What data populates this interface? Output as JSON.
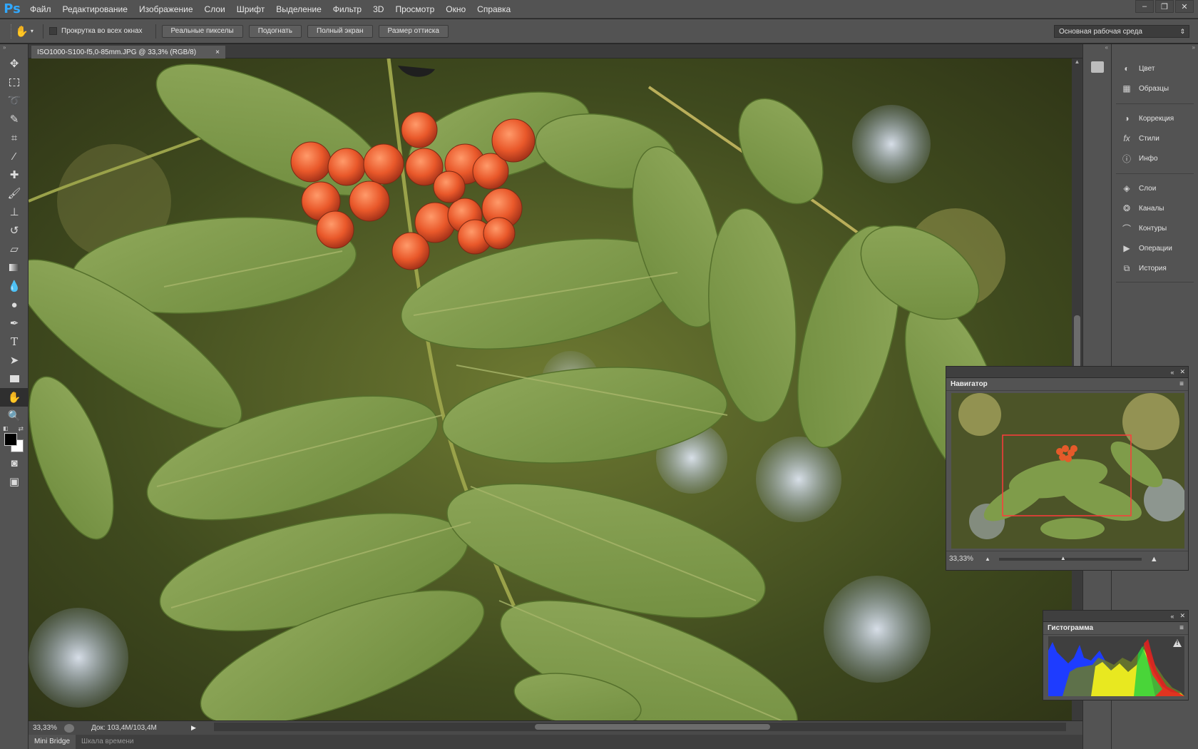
{
  "app": {
    "logo": "Ps"
  },
  "menu": [
    "Файл",
    "Редактирование",
    "Изображение",
    "Слои",
    "Шрифт",
    "Выделение",
    "Фильтр",
    "3D",
    "Просмотр",
    "Окно",
    "Справка"
  ],
  "window_controls": [
    "–",
    "❐",
    "✕"
  ],
  "options": {
    "scroll_all_windows": "Прокрутка во всех окнах",
    "buttons": [
      "Реальные пикселы",
      "Подогнать",
      "Полный экран",
      "Размер оттиска"
    ],
    "workspace": "Основная рабочая среда"
  },
  "document": {
    "tab_title": "ISO1000-S100-f5,0-85mm.JPG @ 33,3% (RGB/8)",
    "close": "×"
  },
  "status": {
    "zoom": "33,33%",
    "doc": "Док: 103,4M/103,4M"
  },
  "bottom_tabs": [
    "Mini Bridge",
    "Шкала времени"
  ],
  "dock": {
    "group1": [
      {
        "label": "Цвет",
        "icon": "color-icon"
      },
      {
        "label": "Образцы",
        "icon": "swatches-icon"
      }
    ],
    "group2": [
      {
        "label": "Коррекция",
        "icon": "adjustments-icon"
      },
      {
        "label": "Стили",
        "icon": "styles-icon"
      },
      {
        "label": "Инфо",
        "icon": "info-icon"
      }
    ],
    "group3": [
      {
        "label": "Слои",
        "icon": "layers-icon"
      },
      {
        "label": "Каналы",
        "icon": "channels-icon"
      },
      {
        "label": "Контуры",
        "icon": "paths-icon"
      },
      {
        "label": "Операции",
        "icon": "actions-icon"
      },
      {
        "label": "История",
        "icon": "history-icon"
      }
    ]
  },
  "navigator": {
    "title": "Навигатор",
    "zoom": "33,33%"
  },
  "histogram": {
    "title": "Гистограмма",
    "warning": "!"
  },
  "colors": {
    "accent": "#31a8ff",
    "ui_bg": "#535353",
    "dark_bg": "#262626",
    "nav_box": "#ff3b3b"
  }
}
